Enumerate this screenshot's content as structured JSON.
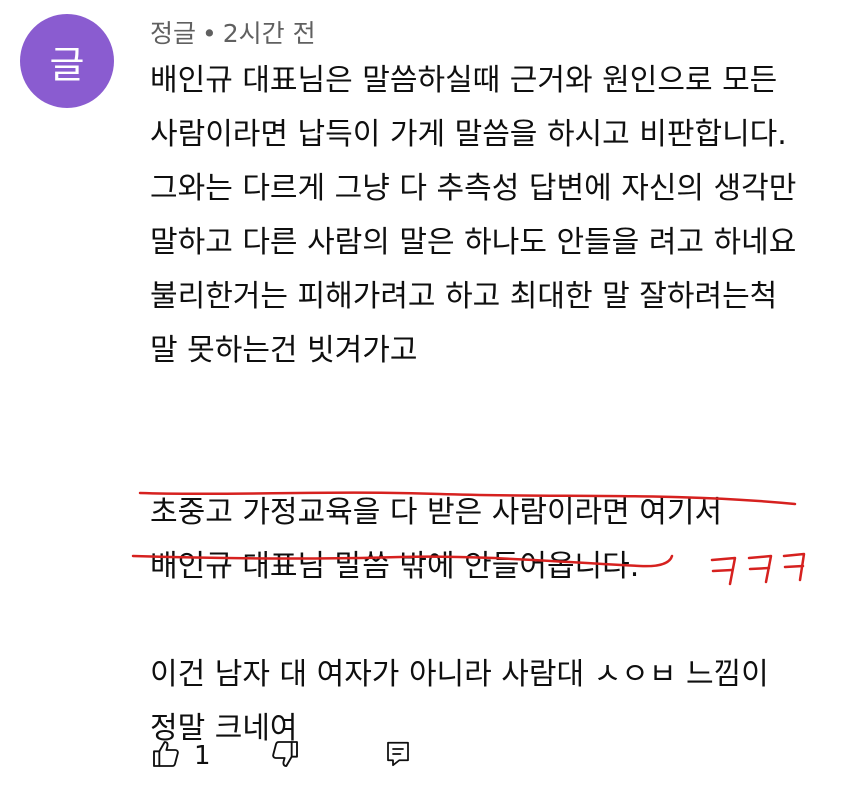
{
  "comment": {
    "avatar_letter": "글",
    "author": "정글",
    "separator": "•",
    "time": "2시간 전",
    "lines": [
      "배인규 대표님은 말씀하실때 근거와 원인으로 모든",
      "사람이라면 납득이 가게 말씀을 하시고 비판합니다.",
      "그와는 다르게 그냥 다 추측성 답변에 자신의 생각만",
      "말하고 다른 사람의 말은 하나도 안들을 려고 하네요",
      "불리한거는 피해가려고 하고 최대한 말 잘하려는척",
      "말 못하는건 빗겨가고",
      "초중고 가정교육을 다 받은 사람이라면 여기서",
      "배인규 대표님 말씀 밖에 안들어옵니다.",
      "이건 남자 대 여자가 아니라 사람대 ㅅㅇㅂ 느낌이",
      "정말 크네여"
    ],
    "handwritten_note": "ㅋㅋㅋ",
    "like_count": "1"
  },
  "colors": {
    "avatar_bg": "#8a5cd0",
    "annotation": "#d6211f",
    "meta_text": "#606060"
  },
  "icons": {
    "like": "thumb-up-icon",
    "dislike": "thumb-down-icon",
    "reply": "comment-icon"
  }
}
